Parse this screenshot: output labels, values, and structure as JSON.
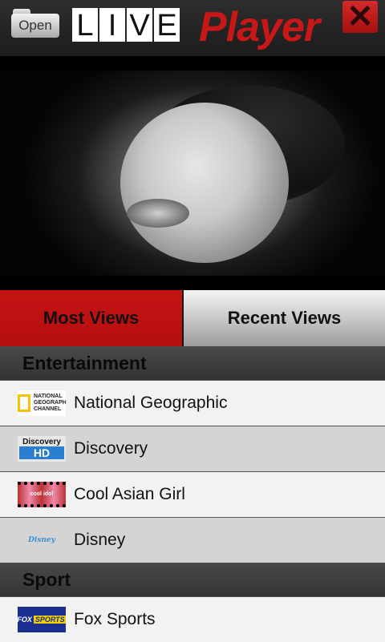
{
  "header": {
    "open_label": "Open",
    "logo_live_letters": [
      "L",
      "I",
      "V",
      "E"
    ],
    "logo_player": "Player",
    "close_symbol": "✕"
  },
  "tabs": [
    {
      "label": "Most Views",
      "active": true
    },
    {
      "label": "Recent Views",
      "active": false
    }
  ],
  "sections": [
    {
      "title": "Entertainment",
      "items": [
        {
          "label": "National Geographic",
          "icon": "national-geographic-icon",
          "icon_text": "NATIONAL GEOGRAPHIC CHANNEL"
        },
        {
          "label": "Discovery",
          "icon": "discovery-hd-icon",
          "icon_text": "Discovery",
          "icon_text2": "HD"
        },
        {
          "label": "Cool Asian Girl",
          "icon": "cool-asian-girl-icon",
          "icon_text": "cool idol"
        },
        {
          "label": "Disney",
          "icon": "disney-icon",
          "icon_text": "Disney"
        }
      ]
    },
    {
      "title": "Sport",
      "items": [
        {
          "label": "Fox Sports",
          "icon": "fox-sports-icon",
          "icon_text": "FOX",
          "icon_text2": "SPORTS"
        }
      ]
    }
  ],
  "colors": {
    "accent_red": "#c51414",
    "header_bg": "#262626",
    "section_bg": "#3b3b3b",
    "row_light": "#f2f2f2",
    "row_dark": "#d4d4d4"
  }
}
